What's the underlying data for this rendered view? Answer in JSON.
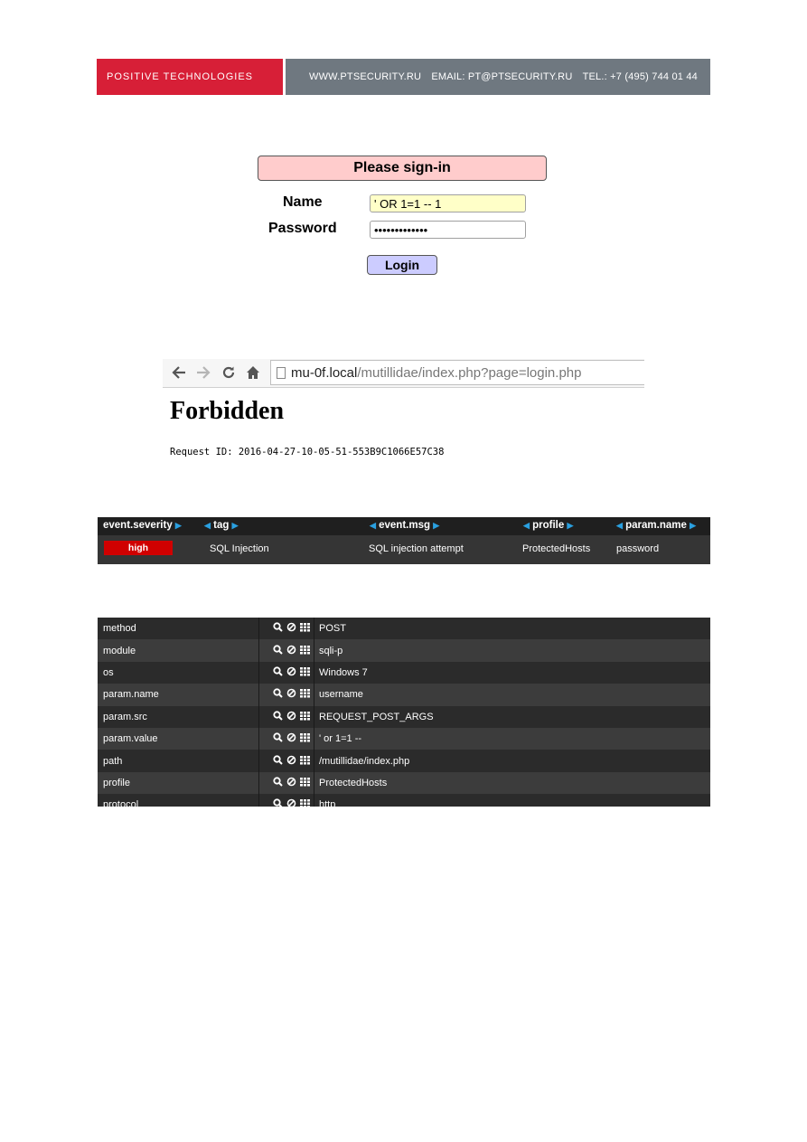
{
  "banner": {
    "brand": "POSITIVE TECHNOLOGIES",
    "website": "WWW.PTSECURITY.RU",
    "email": "EMAIL: PT@PTSECURITY.RU",
    "phone": "TEL.: +7 (495) 744 01 44"
  },
  "login": {
    "header": "Please sign-in",
    "name_label": "Name",
    "password_label": "Password",
    "name_value": "' OR 1=1 -- 1",
    "password_value": "•••••••••••••",
    "button": "Login"
  },
  "browser": {
    "url_host": "mu-0f.local",
    "url_path": "/mutillidae/index.php?page=login.php",
    "title": "Forbidden",
    "request_id": "Request ID: 2016-04-27-10-05-51-553B9C1066E57C38"
  },
  "event_table": {
    "headers": [
      "event.severity",
      "tag",
      "event.msg",
      "profile",
      "param.name"
    ],
    "row": {
      "severity": "high",
      "tag": "SQL Injection",
      "msg": "SQL injection attempt",
      "profile": "ProtectedHosts",
      "param_name": "password"
    },
    "colors": {
      "severity_high": "#d00000",
      "arrow": "#2aa0e0"
    }
  },
  "field_table": {
    "rows": [
      {
        "name": "method",
        "value": "POST"
      },
      {
        "name": "module",
        "value": "sqli-p"
      },
      {
        "name": "os",
        "value": "Windows 7"
      },
      {
        "name": "param.name",
        "value": "username"
      },
      {
        "name": "param.src",
        "value": "REQUEST_POST_ARGS"
      },
      {
        "name": "param.value",
        "value": "' or 1=1 --"
      },
      {
        "name": "path",
        "value": "/mutillidae/index.php"
      },
      {
        "name": "profile",
        "value": "ProtectedHosts"
      },
      {
        "name": "protocol",
        "value": "http"
      }
    ],
    "icons": [
      "search-icon",
      "block-icon",
      "grid-icon"
    ]
  },
  "colors": {
    "brand_red": "#d71f37",
    "banner_gray": "#6f7880",
    "signin_pink": "#ffcccc",
    "login_button": "#ccccff",
    "name_field_yellow": "#ffffc8"
  }
}
